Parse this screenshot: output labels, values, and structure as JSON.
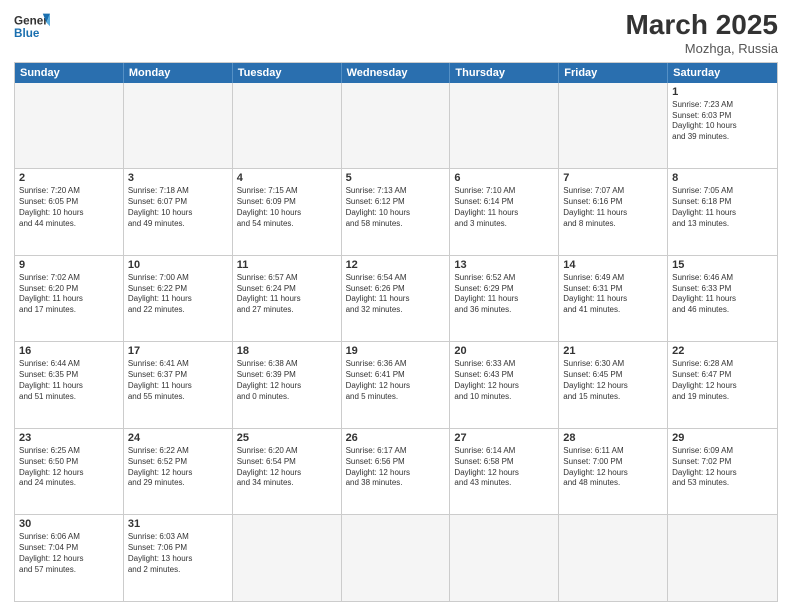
{
  "header": {
    "logo_general": "General",
    "logo_blue": "Blue",
    "month_title": "March 2025",
    "location": "Mozhga, Russia"
  },
  "weekdays": [
    "Sunday",
    "Monday",
    "Tuesday",
    "Wednesday",
    "Thursday",
    "Friday",
    "Saturday"
  ],
  "rows": [
    [
      {
        "day": "",
        "info": ""
      },
      {
        "day": "",
        "info": ""
      },
      {
        "day": "",
        "info": ""
      },
      {
        "day": "",
        "info": ""
      },
      {
        "day": "",
        "info": ""
      },
      {
        "day": "",
        "info": ""
      },
      {
        "day": "1",
        "info": "Sunrise: 7:23 AM\nSunset: 6:03 PM\nDaylight: 10 hours\nand 39 minutes."
      }
    ],
    [
      {
        "day": "2",
        "info": "Sunrise: 7:20 AM\nSunset: 6:05 PM\nDaylight: 10 hours\nand 44 minutes."
      },
      {
        "day": "3",
        "info": "Sunrise: 7:18 AM\nSunset: 6:07 PM\nDaylight: 10 hours\nand 49 minutes."
      },
      {
        "day": "4",
        "info": "Sunrise: 7:15 AM\nSunset: 6:09 PM\nDaylight: 10 hours\nand 54 minutes."
      },
      {
        "day": "5",
        "info": "Sunrise: 7:13 AM\nSunset: 6:12 PM\nDaylight: 10 hours\nand 58 minutes."
      },
      {
        "day": "6",
        "info": "Sunrise: 7:10 AM\nSunset: 6:14 PM\nDaylight: 11 hours\nand 3 minutes."
      },
      {
        "day": "7",
        "info": "Sunrise: 7:07 AM\nSunset: 6:16 PM\nDaylight: 11 hours\nand 8 minutes."
      },
      {
        "day": "8",
        "info": "Sunrise: 7:05 AM\nSunset: 6:18 PM\nDaylight: 11 hours\nand 13 minutes."
      }
    ],
    [
      {
        "day": "9",
        "info": "Sunrise: 7:02 AM\nSunset: 6:20 PM\nDaylight: 11 hours\nand 17 minutes."
      },
      {
        "day": "10",
        "info": "Sunrise: 7:00 AM\nSunset: 6:22 PM\nDaylight: 11 hours\nand 22 minutes."
      },
      {
        "day": "11",
        "info": "Sunrise: 6:57 AM\nSunset: 6:24 PM\nDaylight: 11 hours\nand 27 minutes."
      },
      {
        "day": "12",
        "info": "Sunrise: 6:54 AM\nSunset: 6:26 PM\nDaylight: 11 hours\nand 32 minutes."
      },
      {
        "day": "13",
        "info": "Sunrise: 6:52 AM\nSunset: 6:29 PM\nDaylight: 11 hours\nand 36 minutes."
      },
      {
        "day": "14",
        "info": "Sunrise: 6:49 AM\nSunset: 6:31 PM\nDaylight: 11 hours\nand 41 minutes."
      },
      {
        "day": "15",
        "info": "Sunrise: 6:46 AM\nSunset: 6:33 PM\nDaylight: 11 hours\nand 46 minutes."
      }
    ],
    [
      {
        "day": "16",
        "info": "Sunrise: 6:44 AM\nSunset: 6:35 PM\nDaylight: 11 hours\nand 51 minutes."
      },
      {
        "day": "17",
        "info": "Sunrise: 6:41 AM\nSunset: 6:37 PM\nDaylight: 11 hours\nand 55 minutes."
      },
      {
        "day": "18",
        "info": "Sunrise: 6:38 AM\nSunset: 6:39 PM\nDaylight: 12 hours\nand 0 minutes."
      },
      {
        "day": "19",
        "info": "Sunrise: 6:36 AM\nSunset: 6:41 PM\nDaylight: 12 hours\nand 5 minutes."
      },
      {
        "day": "20",
        "info": "Sunrise: 6:33 AM\nSunset: 6:43 PM\nDaylight: 12 hours\nand 10 minutes."
      },
      {
        "day": "21",
        "info": "Sunrise: 6:30 AM\nSunset: 6:45 PM\nDaylight: 12 hours\nand 15 minutes."
      },
      {
        "day": "22",
        "info": "Sunrise: 6:28 AM\nSunset: 6:47 PM\nDaylight: 12 hours\nand 19 minutes."
      }
    ],
    [
      {
        "day": "23",
        "info": "Sunrise: 6:25 AM\nSunset: 6:50 PM\nDaylight: 12 hours\nand 24 minutes."
      },
      {
        "day": "24",
        "info": "Sunrise: 6:22 AM\nSunset: 6:52 PM\nDaylight: 12 hours\nand 29 minutes."
      },
      {
        "day": "25",
        "info": "Sunrise: 6:20 AM\nSunset: 6:54 PM\nDaylight: 12 hours\nand 34 minutes."
      },
      {
        "day": "26",
        "info": "Sunrise: 6:17 AM\nSunset: 6:56 PM\nDaylight: 12 hours\nand 38 minutes."
      },
      {
        "day": "27",
        "info": "Sunrise: 6:14 AM\nSunset: 6:58 PM\nDaylight: 12 hours\nand 43 minutes."
      },
      {
        "day": "28",
        "info": "Sunrise: 6:11 AM\nSunset: 7:00 PM\nDaylight: 12 hours\nand 48 minutes."
      },
      {
        "day": "29",
        "info": "Sunrise: 6:09 AM\nSunset: 7:02 PM\nDaylight: 12 hours\nand 53 minutes."
      }
    ],
    [
      {
        "day": "30",
        "info": "Sunrise: 6:06 AM\nSunset: 7:04 PM\nDaylight: 12 hours\nand 57 minutes."
      },
      {
        "day": "31",
        "info": "Sunrise: 6:03 AM\nSunset: 7:06 PM\nDaylight: 13 hours\nand 2 minutes."
      },
      {
        "day": "",
        "info": ""
      },
      {
        "day": "",
        "info": ""
      },
      {
        "day": "",
        "info": ""
      },
      {
        "day": "",
        "info": ""
      },
      {
        "day": "",
        "info": ""
      }
    ]
  ]
}
